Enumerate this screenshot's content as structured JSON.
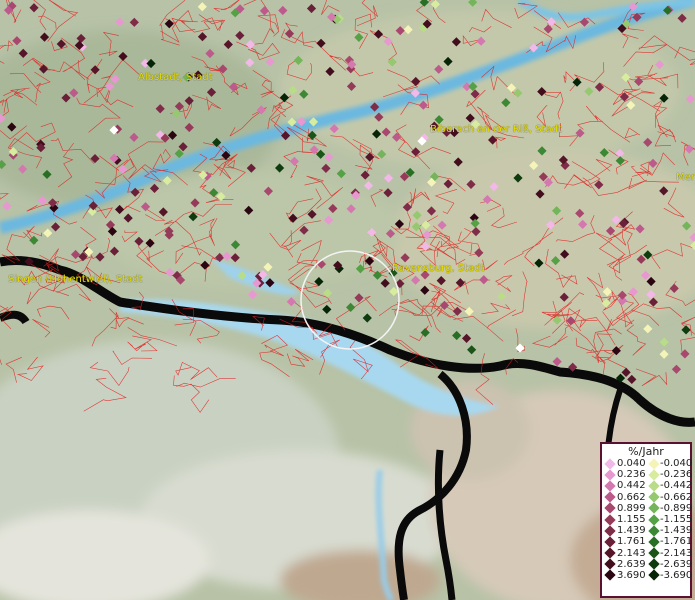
{
  "places": [
    {
      "name": "Albstadt, Stadt"
    },
    {
      "name": "Biberach an der Riß, Stadt"
    },
    {
      "name": "Ravensburg, Stadt"
    },
    {
      "name": "Singen (Hohentwiel), Stadt"
    },
    {
      "name": "Mer"
    }
  ],
  "legend": {
    "title": "%/Jahr",
    "pos": [
      {
        "label": "0.040",
        "color": "#f2b8e8"
      },
      {
        "label": "0.236",
        "color": "#e898d0"
      },
      {
        "label": "0.442",
        "color": "#d478b0"
      },
      {
        "label": "0.662",
        "color": "#bc5a8c"
      },
      {
        "label": "0.899",
        "color": "#a8486e"
      },
      {
        "label": "1.155",
        "color": "#963a5a"
      },
      {
        "label": "1.439",
        "color": "#7e2c48"
      },
      {
        "label": "1.761",
        "color": "#6a2038"
      },
      {
        "label": "2.143",
        "color": "#56162a"
      },
      {
        "label": "2.639",
        "color": "#420e1e"
      },
      {
        "label": "3.690",
        "color": "#2a0612"
      }
    ],
    "neg": [
      {
        "label": "-0.040",
        "color": "#f4f4b8"
      },
      {
        "label": "-0.236",
        "color": "#d8eca0"
      },
      {
        "label": "-0.442",
        "color": "#b8dc88"
      },
      {
        "label": "-0.662",
        "color": "#96c870"
      },
      {
        "label": "-0.899",
        "color": "#74b45a"
      },
      {
        "label": "-1.155",
        "color": "#56a046"
      },
      {
        "label": "-1.439",
        "color": "#3c8834"
      },
      {
        "label": "-1.761",
        "color": "#286e24"
      },
      {
        "label": "-2.143",
        "color": "#1a5418"
      },
      {
        "label": "-2.639",
        "color": "#0e3c0e"
      },
      {
        "label": "-3.690",
        "color": "#062406"
      }
    ]
  }
}
